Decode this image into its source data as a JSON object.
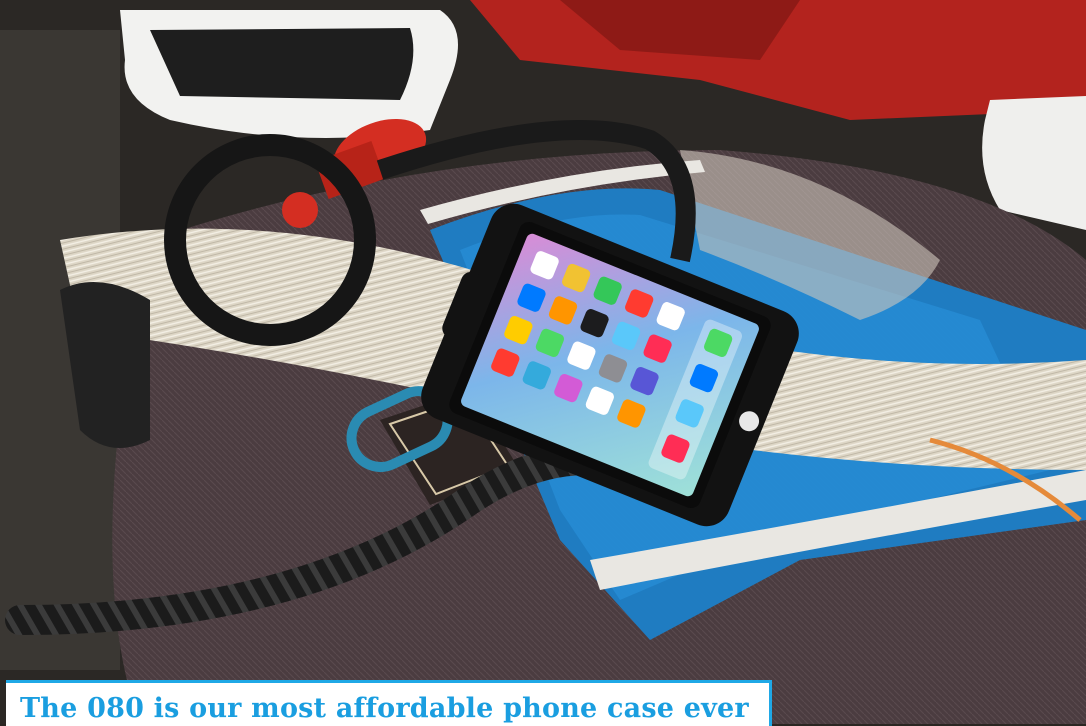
{
  "caption": {
    "text": "The 080 is our most affordable phone case ever",
    "accent_color": "#1fa8e6"
  },
  "photo": {
    "subject": "phone-in-waterproof-case",
    "colors": {
      "bag": "#4a3c3e",
      "blue_panel": "#1c7fc8",
      "kite_lines": "#e6e0d2",
      "red_valve": "#d42e22"
    }
  }
}
